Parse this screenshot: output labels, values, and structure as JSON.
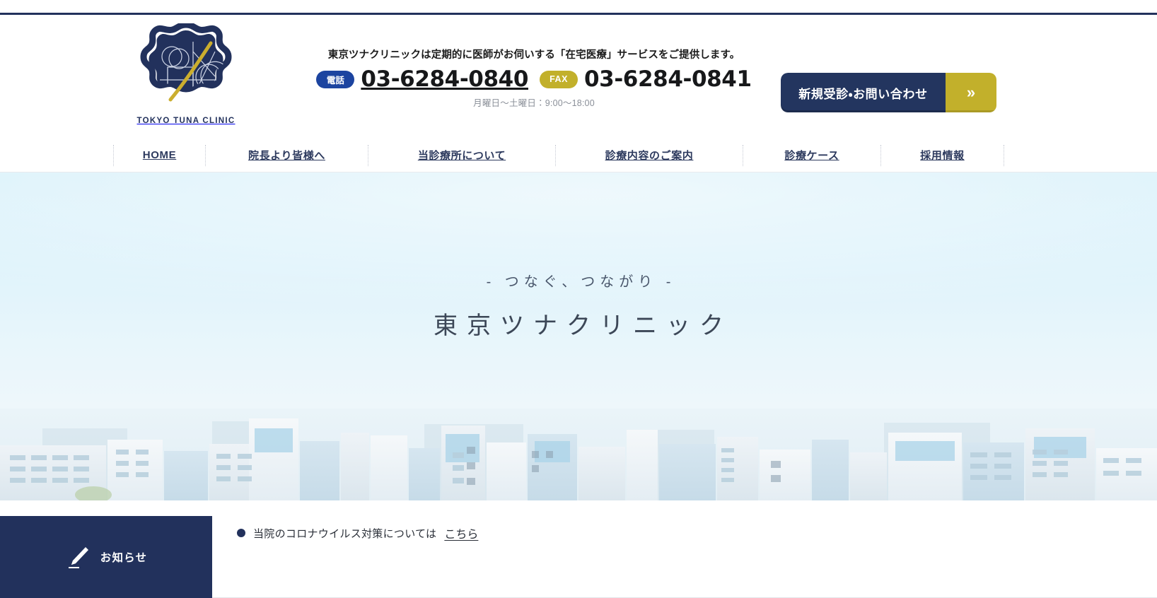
{
  "site": {
    "logo_wordmark": "TOKYO TUNA CLINIC",
    "logo_icon": "tuna-clinic-emblem-icon"
  },
  "header": {
    "tagline": "東京ツナクリニックは定期的に医師がお伺いする「在宅医療」サービスをご提供します。",
    "tel_badge": "電話",
    "tel_number": "03-6284-0840",
    "fax_badge": "FAX",
    "fax_number": "03-6284-0841",
    "hours": "月曜日～土曜日：9:00～18:00",
    "cta_label": "新規受診・お問い合わせ",
    "cta_arrow": "»"
  },
  "nav": {
    "items": [
      {
        "label": "HOME"
      },
      {
        "label": "院長より皆様へ"
      },
      {
        "label": "当診療所について"
      },
      {
        "label": "診療内容のご案内"
      },
      {
        "label": "診療ケース"
      },
      {
        "label": "採用情報"
      }
    ]
  },
  "hero": {
    "subtitle": "- つなぐ、つながり -",
    "title": "東京ツナクリニック"
  },
  "news": {
    "label": "お知らせ",
    "label_icon": "pen-icon",
    "items": [
      {
        "bullet": "●",
        "text": "当院のコロナウイルス対策については ",
        "link": "こちら"
      }
    ]
  },
  "colors": {
    "navy": "#22315c",
    "gold": "#c2b02b",
    "tel_blue": "#1c44a0",
    "sky": "#dff3fb"
  }
}
